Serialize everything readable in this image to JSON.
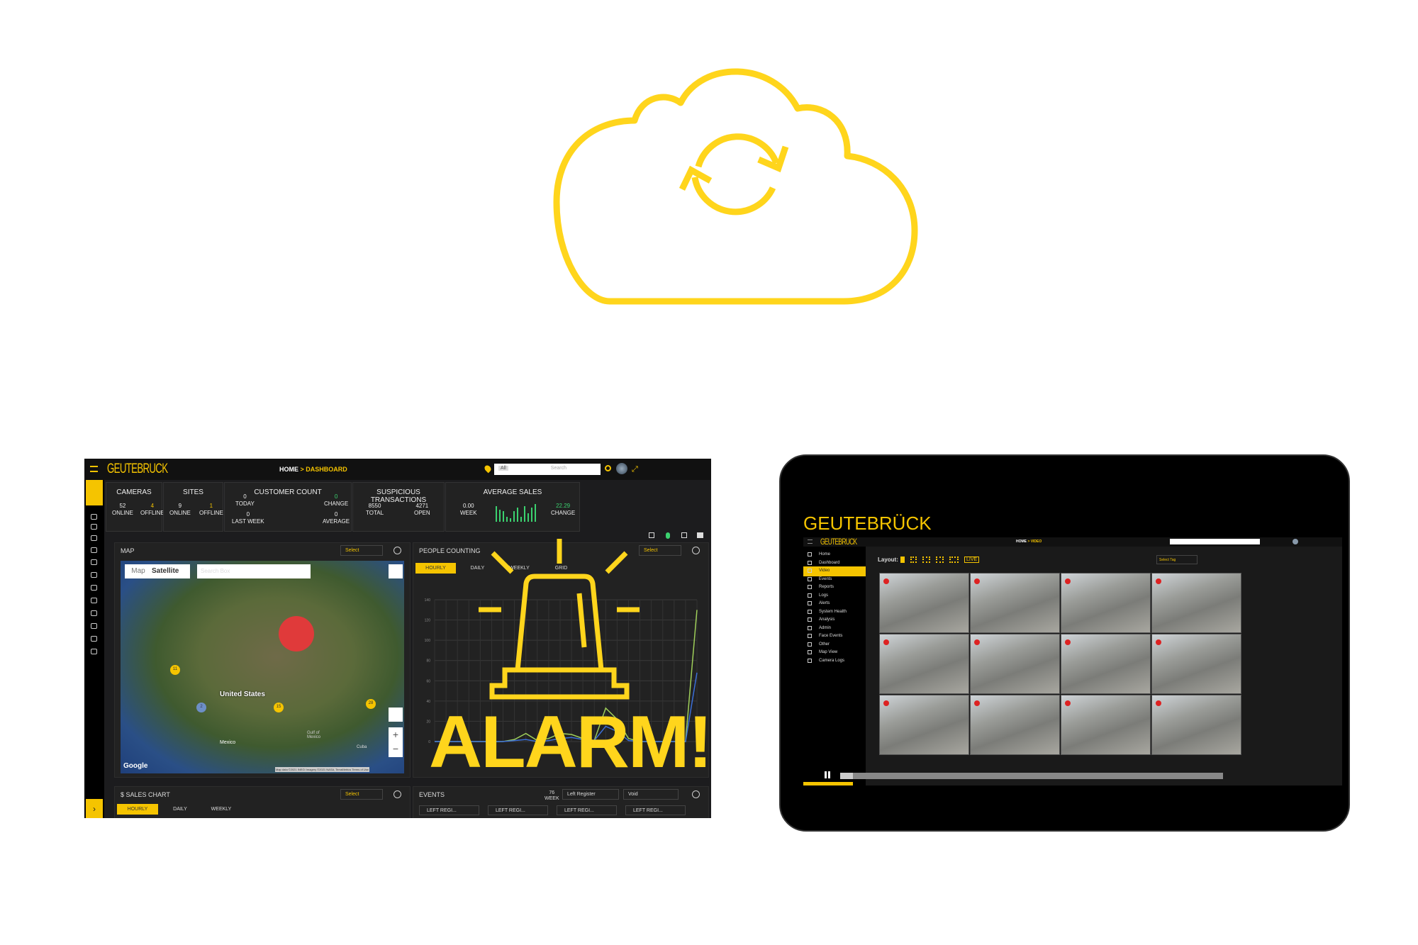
{
  "colors": {
    "brand_yellow": "#f5c400",
    "positive_green": "#3bd16f",
    "alarm_yellow": "#ffd51c"
  },
  "icons": [
    "cloud-sync-icon",
    "siren-icon",
    "menu-icon",
    "home-icon",
    "location-pin-icon",
    "search-icon",
    "expand-icon"
  ],
  "dashboard": {
    "logo": "GEUTEBRUCK",
    "breadcrumb": {
      "home": "HOME",
      "sep": ">",
      "page": "DASHBOARD"
    },
    "search": {
      "scope": "All",
      "placeholder": "Search"
    },
    "kpis": {
      "cameras": {
        "title": "CAMERAS",
        "online": "52",
        "online_label": "ONLINE",
        "offline": "4",
        "offline_label": "OFFLINE"
      },
      "sites": {
        "title": "SITES",
        "online": "9",
        "online_label": "ONLINE",
        "offline": "1",
        "offline_label": "OFFLINE"
      },
      "customer_count": {
        "title": "CUSTOMER COUNT",
        "today": "0",
        "today_label": "TODAY",
        "last_week": "0",
        "last_week_label": "LAST WEEK",
        "change": "0",
        "change_label": "CHANGE",
        "average": "0",
        "average_label": "AVERAGE"
      },
      "suspicious": {
        "title": "SUSPICIOUS TRANSACTIONS",
        "total": "8550",
        "total_label": "TOTAL",
        "open": "4271",
        "open_label": "OPEN"
      },
      "avg_sales": {
        "title": "AVERAGE SALES",
        "week": "0.00",
        "week_label": "WEEK",
        "change": "22.29",
        "change_label": "CHANGE",
        "spark": [
          9,
          7,
          6,
          3,
          2,
          6,
          8,
          3,
          9,
          5,
          8,
          10
        ]
      }
    },
    "map": {
      "title": "MAP",
      "select": "Select",
      "btn_map": "Map",
      "btn_satellite": "Satellite",
      "search_placeholder": "Search Box",
      "country": "United States",
      "labels": {
        "mexico": "Mexico",
        "gulf": "Gulf of Mexico",
        "cuba": "Cuba"
      },
      "clusters": [
        "11",
        "15",
        "28",
        "2"
      ],
      "google": "Google",
      "attribution": "Map data ©2021 INEGI Imagery ©2021 NASA, TerraMetrics  Terms of Use"
    },
    "people_counting": {
      "title": "PEOPLE COUNTING",
      "select": "Select",
      "tabs": [
        "HOURLY",
        "DAILY",
        "WEEKLY",
        "GRID"
      ],
      "y_ticks": [
        0,
        20,
        40,
        60,
        80,
        100,
        120,
        140
      ],
      "series": [
        {
          "color": "#9fcf5a",
          "values": [
            0,
            0,
            0,
            0,
            0,
            0,
            0,
            2,
            8,
            1,
            3,
            8,
            7,
            3,
            1,
            33,
            22,
            3,
            0,
            0,
            0,
            0,
            0,
            130
          ]
        },
        {
          "color": "#3b6fd8",
          "values": [
            0,
            0,
            0,
            0,
            0,
            0,
            0,
            1,
            2,
            0,
            1,
            3,
            4,
            2,
            1,
            15,
            10,
            1,
            0,
            0,
            0,
            0,
            0,
            68
          ]
        }
      ]
    },
    "sales_chart": {
      "title": "$ SALES CHART",
      "select": "Select",
      "tabs": [
        "HOURLY",
        "DAILY",
        "WEEKLY"
      ]
    },
    "events": {
      "title": "EVENTS",
      "count": "76",
      "period": "WEEK",
      "filter1": "Left Register",
      "filter2": "Void",
      "cards": [
        "LEFT REGI...",
        "LEFT REGI...",
        "LEFT REGI...",
        "LEFT REGI..."
      ]
    }
  },
  "alarm": {
    "text": "ALARM!"
  },
  "tablet": {
    "brand": "GEUTEBRÜCK",
    "logo": "GEUTEBRUCK",
    "breadcrumb": {
      "home": "HOME",
      "sep": ">",
      "page": "VIDEO"
    },
    "nav": [
      "Home",
      "Dashboard",
      "Video",
      "Events",
      "Reports",
      "Logs",
      "Alerts",
      "System Health",
      "Analysis",
      "Admin",
      "Face Events",
      "Other",
      "Map View",
      "Camera Logs"
    ],
    "active_nav": "Video",
    "layout_label": "Layout:",
    "live": "LIVE",
    "tag_select": "Select Tag",
    "camera_count": 12
  }
}
